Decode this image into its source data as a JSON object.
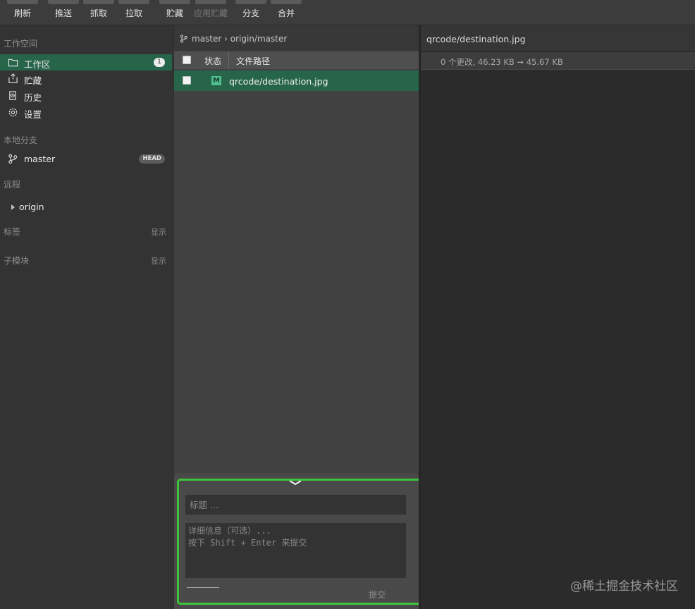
{
  "toolbar": {
    "buttons": [
      {
        "label": "刷新",
        "enabled": true
      },
      {
        "label": "推送",
        "enabled": true
      },
      {
        "label": "抓取",
        "enabled": true
      },
      {
        "label": "拉取",
        "enabled": true
      },
      {
        "label": "贮藏",
        "enabled": true
      },
      {
        "label": "应用贮藏",
        "enabled": false
      },
      {
        "label": "分支",
        "enabled": true
      },
      {
        "label": "合并",
        "enabled": true
      }
    ]
  },
  "sidebar": {
    "workspace_title": "工作空间",
    "workspace_items": [
      {
        "label": "工作区",
        "icon": "folder-icon",
        "badge": "1",
        "active": true
      },
      {
        "label": "贮藏",
        "icon": "stash-icon"
      },
      {
        "label": "历史",
        "icon": "history-icon"
      },
      {
        "label": "设置",
        "icon": "gear-icon"
      }
    ],
    "local_branches_title": "本地分支",
    "local_branch": {
      "label": "master",
      "badge": "HEAD",
      "icon": "branch-icon"
    },
    "remotes_title": "远程",
    "remote": {
      "label": "origin",
      "icon": "caret-right-icon"
    },
    "tags_title": "标签",
    "tags_show": "显示",
    "submodules_title": "子模块",
    "submodules_show": "显示"
  },
  "middle": {
    "branch_path": "master › origin/master",
    "columns": {
      "status": "状态",
      "path": "文件路径"
    },
    "files": [
      {
        "status": "M",
        "path": "qrcode/destination.jpg"
      }
    ]
  },
  "commit": {
    "title_placeholder": "标题 ...",
    "description_placeholder": "详细信息（可选）...\n按下 Shift + Enter 来提交",
    "commit_label": "提交"
  },
  "right": {
    "file_title": "qrcode/destination.jpg",
    "diff_summary": "0 个更改, 46.23 KB ➞ 45.67 KB"
  },
  "watermark": "@稀土掘金技术社区",
  "colors": {
    "accent": "#27654a",
    "modified_badge": "#4fc08d",
    "highlight": "#3ec43a"
  }
}
